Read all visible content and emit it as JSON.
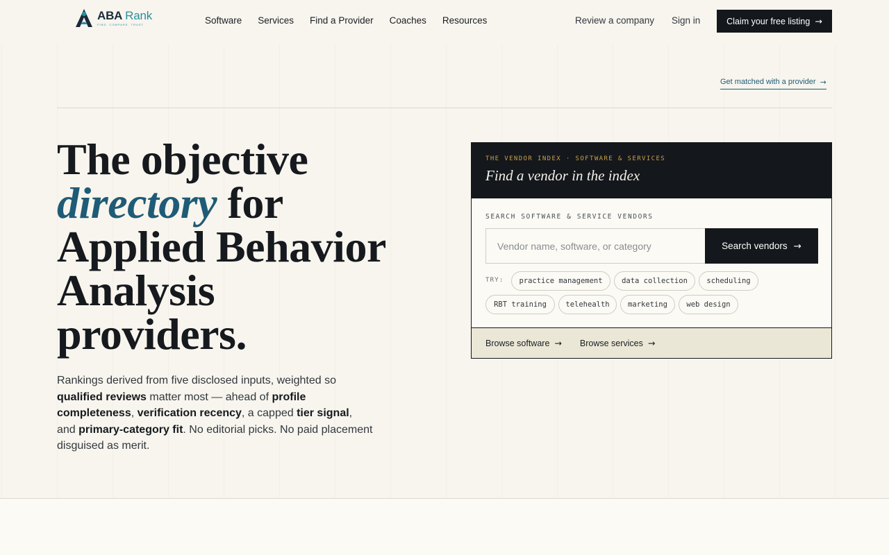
{
  "brand": {
    "name_a": "ABA",
    "name_b": "Rank",
    "tagline": "FIND. COMPARE. TRUST."
  },
  "nav": [
    {
      "label": "Software"
    },
    {
      "label": "Services"
    },
    {
      "label": "Find a Provider"
    },
    {
      "label": "Coaches"
    },
    {
      "label": "Resources"
    }
  ],
  "header": {
    "review": "Review a company",
    "signin": "Sign in",
    "claim": "Claim your free listing"
  },
  "matched_link": "Get matched with a provider",
  "hero": {
    "line1": "The objective",
    "accent": "directory",
    "line2_rest": " for",
    "line3": "Applied Behavior",
    "line4": "Analysis",
    "line5": "providers.",
    "desc": [
      {
        "text": "Rankings derived from five disclosed inputs, weighted so ",
        "bold": false
      },
      {
        "text": "qualified reviews",
        "bold": true
      },
      {
        "text": " matter most — ahead of ",
        "bold": false
      },
      {
        "text": "profile completeness",
        "bold": true
      },
      {
        "text": ", ",
        "bold": false
      },
      {
        "text": "verification recency",
        "bold": true
      },
      {
        "text": ", a capped ",
        "bold": false
      },
      {
        "text": "tier signal",
        "bold": true
      },
      {
        "text": ", and ",
        "bold": false
      },
      {
        "text": "primary-category fit",
        "bold": true
      },
      {
        "text": ". No editorial picks. No paid placement disguised as merit.",
        "bold": false
      }
    ]
  },
  "panel": {
    "eyebrow": "THE VENDOR INDEX · SOFTWARE & SERVICES",
    "title": "Find a vendor in the index",
    "search_label": "SEARCH SOFTWARE & SERVICE VENDORS",
    "placeholder": "Vendor name, software, or category",
    "search_button": "Search vendors",
    "try_label": "TRY:",
    "chips": [
      "practice management",
      "data collection",
      "scheduling",
      "RBT training",
      "telehealth",
      "marketing",
      "web design"
    ],
    "browse_software": "Browse software",
    "browse_services": "Browse services"
  },
  "colors": {
    "accent": "#1f5b76",
    "dark": "#14171b",
    "gold": "#c9a14a",
    "background": "#f7f5ee"
  },
  "icons": {
    "arrow": "arrow-right-icon",
    "logo": "aba-rank-logo"
  }
}
